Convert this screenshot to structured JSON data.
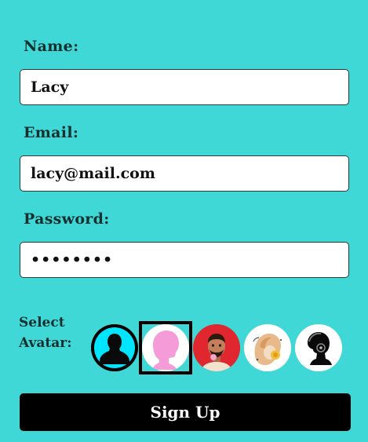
{
  "form": {
    "name_label": "Name:",
    "name_value": "Lacy",
    "email_label": "Email:",
    "email_value": "lacy@mail.com",
    "password_label": "Password:",
    "password_value": "••••••••",
    "avatar_label_line1": "Select",
    "avatar_label_line2": "Avatar:",
    "avatars": [
      {
        "name": "silhouette-cyan",
        "selected": false
      },
      {
        "name": "silhouette-pink",
        "selected": true
      },
      {
        "name": "man-red-background",
        "selected": false
      },
      {
        "name": "woman-headphones",
        "selected": false
      },
      {
        "name": "afro-headphones-bw",
        "selected": false
      }
    ],
    "submit_label": "Sign Up"
  },
  "colors": {
    "background": "#3fd8d6",
    "button": "#000000",
    "accent_cyan": "#00e5ff",
    "accent_pink": "#f59bd8",
    "accent_red": "#e0262f"
  }
}
